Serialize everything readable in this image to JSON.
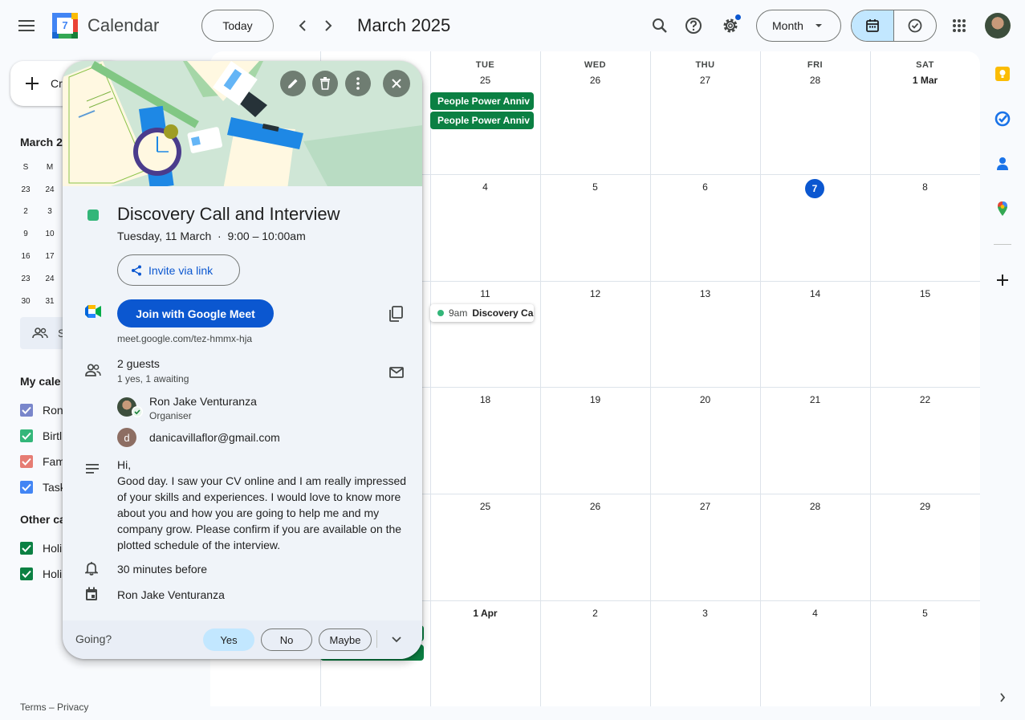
{
  "header": {
    "app_title": "Calendar",
    "logo_day": "7",
    "today_label": "Today",
    "current_period": "March 2025",
    "view_label": "Month"
  },
  "sidebar": {
    "create_label": "Cr",
    "mini_month_title": "March 2",
    "mini_weekdays": [
      "S",
      "M"
    ],
    "mini_rows": [
      [
        "23",
        "24"
      ],
      [
        "2",
        "3"
      ],
      [
        "9",
        "10"
      ],
      [
        "16",
        "17"
      ],
      [
        "23",
        "24"
      ],
      [
        "30",
        "31"
      ]
    ],
    "search_people": "S",
    "my_calendars_title": "My cale",
    "my_calendars": [
      {
        "label": "Ron",
        "color": "#7986cb"
      },
      {
        "label": "Birtl",
        "color": "#33b679"
      },
      {
        "label": "Fam",
        "color": "#e67c73"
      },
      {
        "label": "Task",
        "color": "#4285f4"
      }
    ],
    "other_calendars_title": "Other ca",
    "other_calendars": [
      {
        "label": "Holi",
        "color": "#0b8043"
      },
      {
        "label": "Holi",
        "color": "#0b8043"
      }
    ],
    "footer": "Terms – Privacy"
  },
  "grid": {
    "weekdays": [
      "",
      "",
      "TUE",
      "WED",
      "THU",
      "FRI",
      "SAT"
    ],
    "weeks": [
      [
        "",
        "",
        "25",
        "26",
        "27",
        "28",
        "1 Mar"
      ],
      [
        "",
        "",
        "4",
        "5",
        "6",
        "7",
        "8"
      ],
      [
        "",
        "",
        "11",
        "12",
        "13",
        "14",
        "15"
      ],
      [
        "",
        "",
        "18",
        "19",
        "20",
        "21",
        "22"
      ],
      [
        "",
        "",
        "25",
        "26",
        "27",
        "28",
        "29"
      ],
      [
        "",
        "",
        "1 Apr",
        "2",
        "3",
        "4",
        "5"
      ]
    ],
    "today": "7",
    "events": {
      "anniv1": "People Power Anniv",
      "anniv2": "People Power Anniv",
      "discovery_time": "9am",
      "discovery_title": "Discovery Cal"
    },
    "colors": {
      "holiday": "#0b8043",
      "event": "#33b679",
      "today": "#0b57d0"
    }
  },
  "popup": {
    "title": "Discovery Call and Interview",
    "when": "Tuesday, 11 March  ·  9:00 – 10:00am",
    "invite_label": "Invite via link",
    "join_label": "Join with Google Meet",
    "meet_url": "meet.google.com/tez-hmmx-hja",
    "guests_count": "2 guests",
    "guests_summary": "1 yes, 1 awaiting",
    "guests": [
      {
        "name": "Ron Jake Venturanza",
        "role": "Organiser"
      },
      {
        "name": "danicavillaflor@gmail.com",
        "initial": "d"
      }
    ],
    "description": "Hi,\nGood day. I saw your CV online and I am really impressed of your skills and experiences. I would love to know more about you and how you are going to help me and my company grow. Please confirm if you are available on the plotted schedule of the interview.",
    "reminder": "30 minutes before",
    "calendar_owner": "Ron Jake Venturanza",
    "rsvp": {
      "question": "Going?",
      "yes": "Yes",
      "no": "No",
      "maybe": "Maybe"
    }
  }
}
